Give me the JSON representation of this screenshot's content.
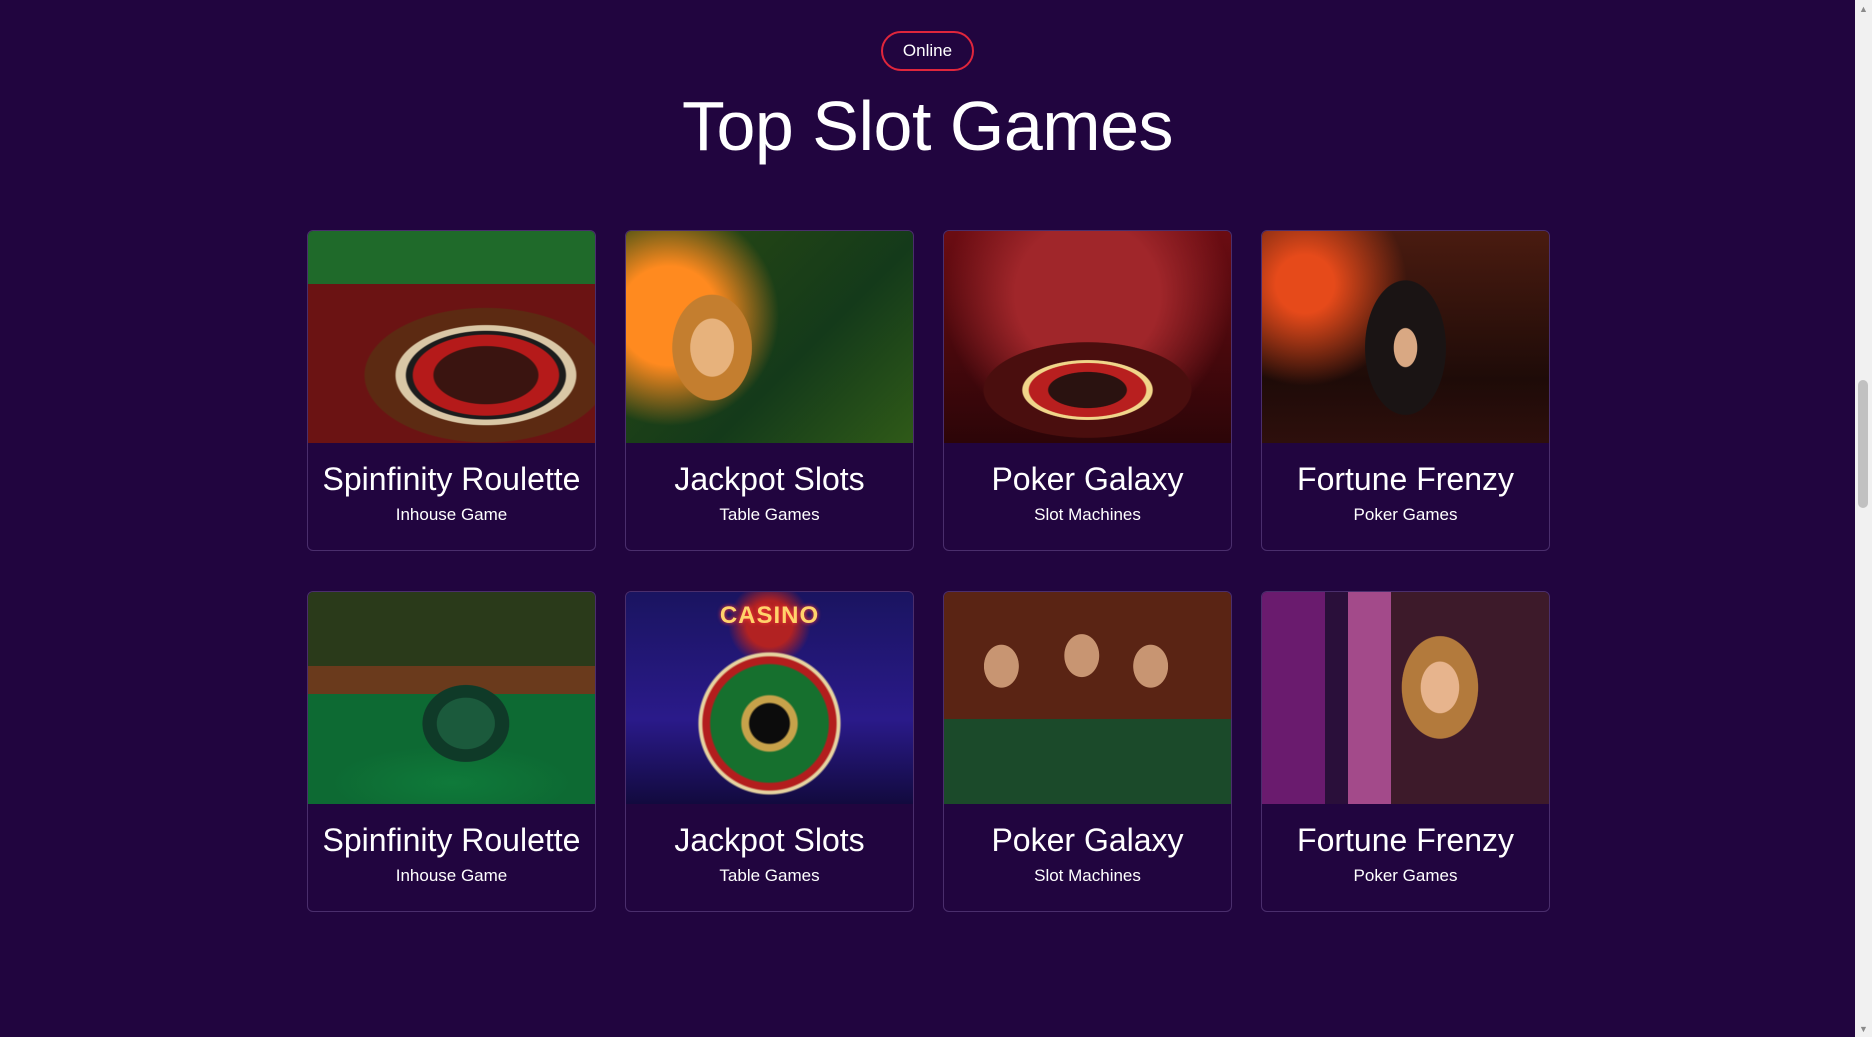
{
  "header": {
    "badge": "Online",
    "title": "Top Slot Games"
  },
  "games": [
    {
      "title": "Spinfinity Roulette",
      "category": "Inhouse Game",
      "image": "roulette-wheel-image"
    },
    {
      "title": "Jackpot Slots",
      "category": "Table Games",
      "image": "woman-with-cards-image"
    },
    {
      "title": "Poker Galaxy",
      "category": "Slot Machines",
      "image": "poker-table-image"
    },
    {
      "title": "Fortune Frenzy",
      "category": "Poker Games",
      "image": "woman-in-hat-image"
    },
    {
      "title": "Spinfinity Roulette",
      "category": "Inhouse Game",
      "image": "chip-stacks-image"
    },
    {
      "title": "Jackpot Slots",
      "category": "Table Games",
      "image": "casino-roulette-image",
      "sign_text": "CASINO"
    },
    {
      "title": "Poker Galaxy",
      "category": "Slot Machines",
      "image": "friends-at-table-image"
    },
    {
      "title": "Fortune Frenzy",
      "category": "Poker Games",
      "image": "woman-at-slots-image"
    }
  ],
  "colors": {
    "background": "#21053f",
    "badge_border": "#e0263c",
    "card_border": "#4a2e6c",
    "text": "#ffffff"
  }
}
